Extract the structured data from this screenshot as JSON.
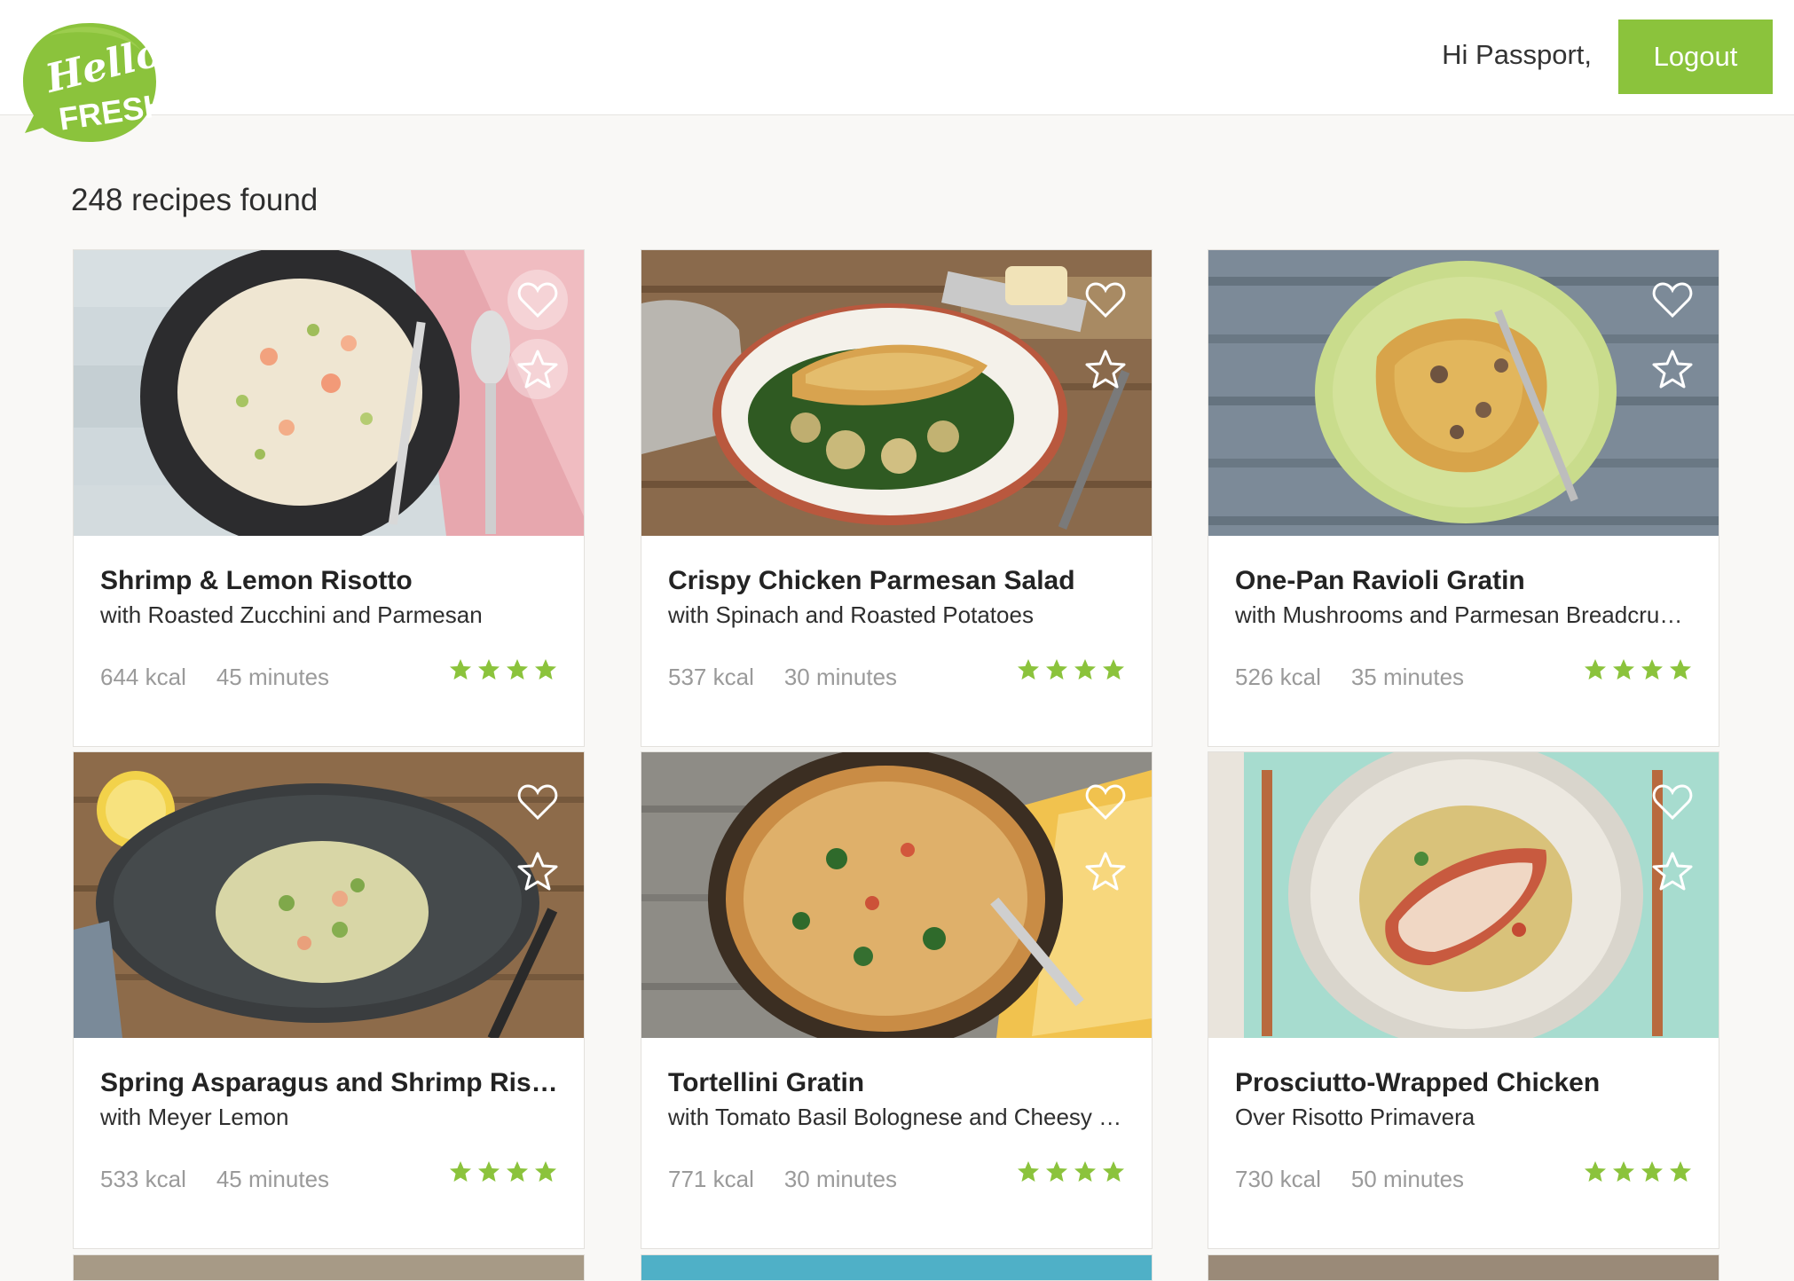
{
  "header": {
    "logo_text_1": "Hello",
    "logo_text_2": "FRESH",
    "greeting": "Hi Passport,",
    "logout_label": "Logout"
  },
  "results": {
    "count_label": "248 recipes found"
  },
  "colors": {
    "brand_green": "#8bc33c",
    "star_green": "#8bc33c",
    "meta_gray": "#9a9a9a"
  },
  "recipes": [
    {
      "title": "Shrimp & Lemon Risotto",
      "subtitle": "with Roasted Zucchini and Parmesan",
      "kcal": "644 kcal",
      "time": "45 minutes",
      "rating_stars": 4
    },
    {
      "title": "Crispy Chicken Parmesan Salad",
      "subtitle": "with Spinach and Roasted Potatoes",
      "kcal": "537 kcal",
      "time": "30 minutes",
      "rating_stars": 4
    },
    {
      "title": "One-Pan Ravioli Gratin",
      "subtitle": "with Mushrooms and Parmesan Breadcrumbs",
      "kcal": "526 kcal",
      "time": "35 minutes",
      "rating_stars": 4
    },
    {
      "title": "Spring Asparagus and Shrimp Risotto",
      "subtitle": "with Meyer Lemon",
      "kcal": "533 kcal",
      "time": "45 minutes",
      "rating_stars": 4
    },
    {
      "title": "Tortellini Gratin",
      "subtitle": "with Tomato Basil Bolognese and Cheesy Breadcrumbs",
      "kcal": "771 kcal",
      "time": "30 minutes",
      "rating_stars": 4
    },
    {
      "title": "Prosciutto-Wrapped Chicken",
      "subtitle": "Over Risotto Primavera",
      "kcal": "730 kcal",
      "time": "50 minutes",
      "rating_stars": 4
    }
  ]
}
